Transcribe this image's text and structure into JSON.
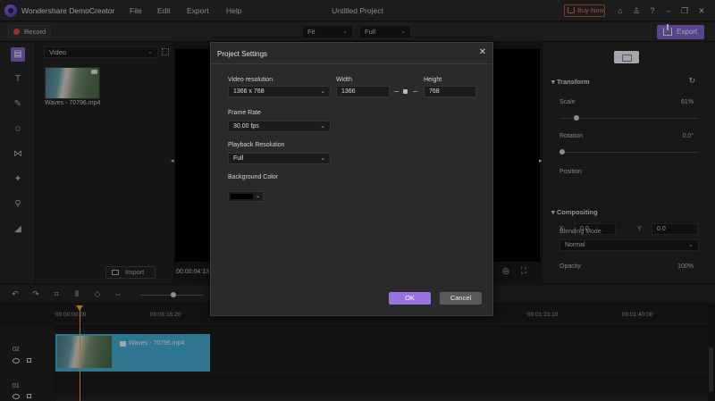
{
  "app": {
    "name": "Wondershare DemoCreator",
    "project_title": "Untitled Project",
    "menu": [
      "File",
      "Edit",
      "Export",
      "Help"
    ],
    "buy_now": "Buy Now"
  },
  "toolbar": {
    "record_label": "Record",
    "fit_select": "Fit",
    "quality_select": "Full",
    "export_label": "Export"
  },
  "library": {
    "category": "Video",
    "media_name": "Waves - 70796.mp4",
    "import_label": "Import"
  },
  "preview": {
    "timecode": "00:00:04:13"
  },
  "properties": {
    "transform_title": "Transform",
    "scale_label": "Scale",
    "scale_value": "61%",
    "scale_level": 0.61,
    "rotation_label": "Rotation",
    "rotation_value": "0.0°",
    "position_label": "Position",
    "x_label": "X",
    "x_value": "0.0",
    "y_label": "Y",
    "y_value": "0.0",
    "compositing_title": "Compositing",
    "blending_label": "Blending Mode",
    "blending_value": "Normal",
    "opacity_label": "Opacity",
    "opacity_value": "100%"
  },
  "timeline": {
    "ruler_labels": [
      "00:00:00:00",
      "00:00:16:20",
      "00:01:23:10",
      "00:01:40:00"
    ],
    "tracks": [
      {
        "number": "02",
        "clip_name": "Waves - 70796.mp4"
      },
      {
        "number": "01"
      }
    ]
  },
  "dialog": {
    "title": "Project Settings",
    "video_resolution_label": "Video resolution",
    "video_resolution_value": "1366 x 768",
    "width_label": "Width",
    "width_value": "1366",
    "height_label": "Height",
    "height_value": "768",
    "frame_rate_label": "Frame Rate",
    "frame_rate_value": "30.00 fps",
    "playback_resolution_label": "Playback Resolution",
    "playback_resolution_value": "Full",
    "background_color_label": "Background Color",
    "background_color": "#000000",
    "ok_label": "OK",
    "cancel_label": "Cancel"
  },
  "colors": {
    "accent": "#8b6bd9",
    "clip": "#49b7de",
    "playhead": "#e8b93a",
    "buy_now": "#f07a55"
  }
}
